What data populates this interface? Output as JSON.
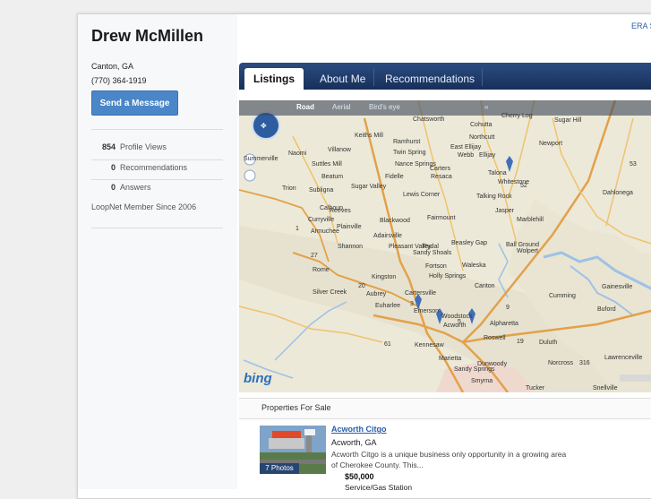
{
  "profile": {
    "name": "Drew McMillen",
    "location": "Canton, GA",
    "phone": "(770) 364-1919",
    "send_message_label": "Send a Message",
    "stats": [
      {
        "value": "854",
        "label": "Profile Views"
      },
      {
        "value": "0",
        "label": "Recommendations"
      },
      {
        "value": "0",
        "label": "Answers"
      }
    ],
    "member_since": "LoopNet Member Since 2006",
    "company": "ERA S"
  },
  "tabs": [
    {
      "label": "Listings"
    },
    {
      "label": "About Me"
    },
    {
      "label": "Recommendations"
    }
  ],
  "map": {
    "modes": [
      "Road",
      "Aerial",
      "Bird's eye"
    ],
    "active_mode": "Road",
    "provider": "bing",
    "cities": [
      "Chatsworth",
      "Cherry Log",
      "Sugar Hill",
      "Cohutta",
      "Keiths Mill",
      "Northcutt",
      "Ramhurst",
      "East Ellijay",
      "Ellijay",
      "Newport",
      "Naomi",
      "Villanow",
      "Twin Spring",
      "Webb",
      "Talona",
      "Whitestone",
      "Summerville",
      "Suttles Mill",
      "Nance Springs",
      "Carters",
      "Resaca",
      "Sugar Valley",
      "Trion",
      "Subligna",
      "Beatum",
      "Fidelle",
      "Jasper",
      "Dahlonega",
      "Lewis Corner",
      "Talking Rock",
      "Ball Ground",
      "Calhoun",
      "Fairmount",
      "Marblehill",
      "Reeves",
      "Curryville",
      "Blackwood",
      "Plainville",
      "Armuchee",
      "Adairsville",
      "Pleasant Valley",
      "Rydal",
      "Sandy Shoals",
      "Beasley Gap",
      "Wolpert",
      "Shannon",
      "Waleska",
      "Fortson",
      "Holly Springs",
      "Rome",
      "Kingston",
      "Cartersville",
      "Canton",
      "Emerson",
      "Aubrey",
      "Euharlee",
      "Silver Creek",
      "Acworth",
      "Kennesaw",
      "Marietta",
      "Smyrna",
      "Alpharetta",
      "Roswell",
      "Dunwoody",
      "Sandy Springs",
      "Duluth",
      "Woodstock",
      "Cumming",
      "Buford",
      "Gainesville",
      "Lawrenceville",
      "Norcross",
      "Tucker",
      "Snellville"
    ],
    "road_labels": [
      "52",
      "53",
      "20",
      "61",
      "3",
      "5",
      "9",
      "19",
      "316",
      "1",
      "27"
    ]
  },
  "listings": {
    "section_title": "Properties For Sale",
    "items": [
      {
        "title": "Acworth Citgo",
        "city": "Acworth, GA",
        "description": "Acworth Citgo is a unique business only opportunity in a growing area of Cherokee County. This...",
        "price": "$50,000",
        "type": "Service/Gas Station",
        "photo_count": "7 Photos"
      }
    ]
  },
  "colors": {
    "accent": "#4a86c8",
    "tabbar": "#1f3a68",
    "link": "#2a5da8"
  }
}
